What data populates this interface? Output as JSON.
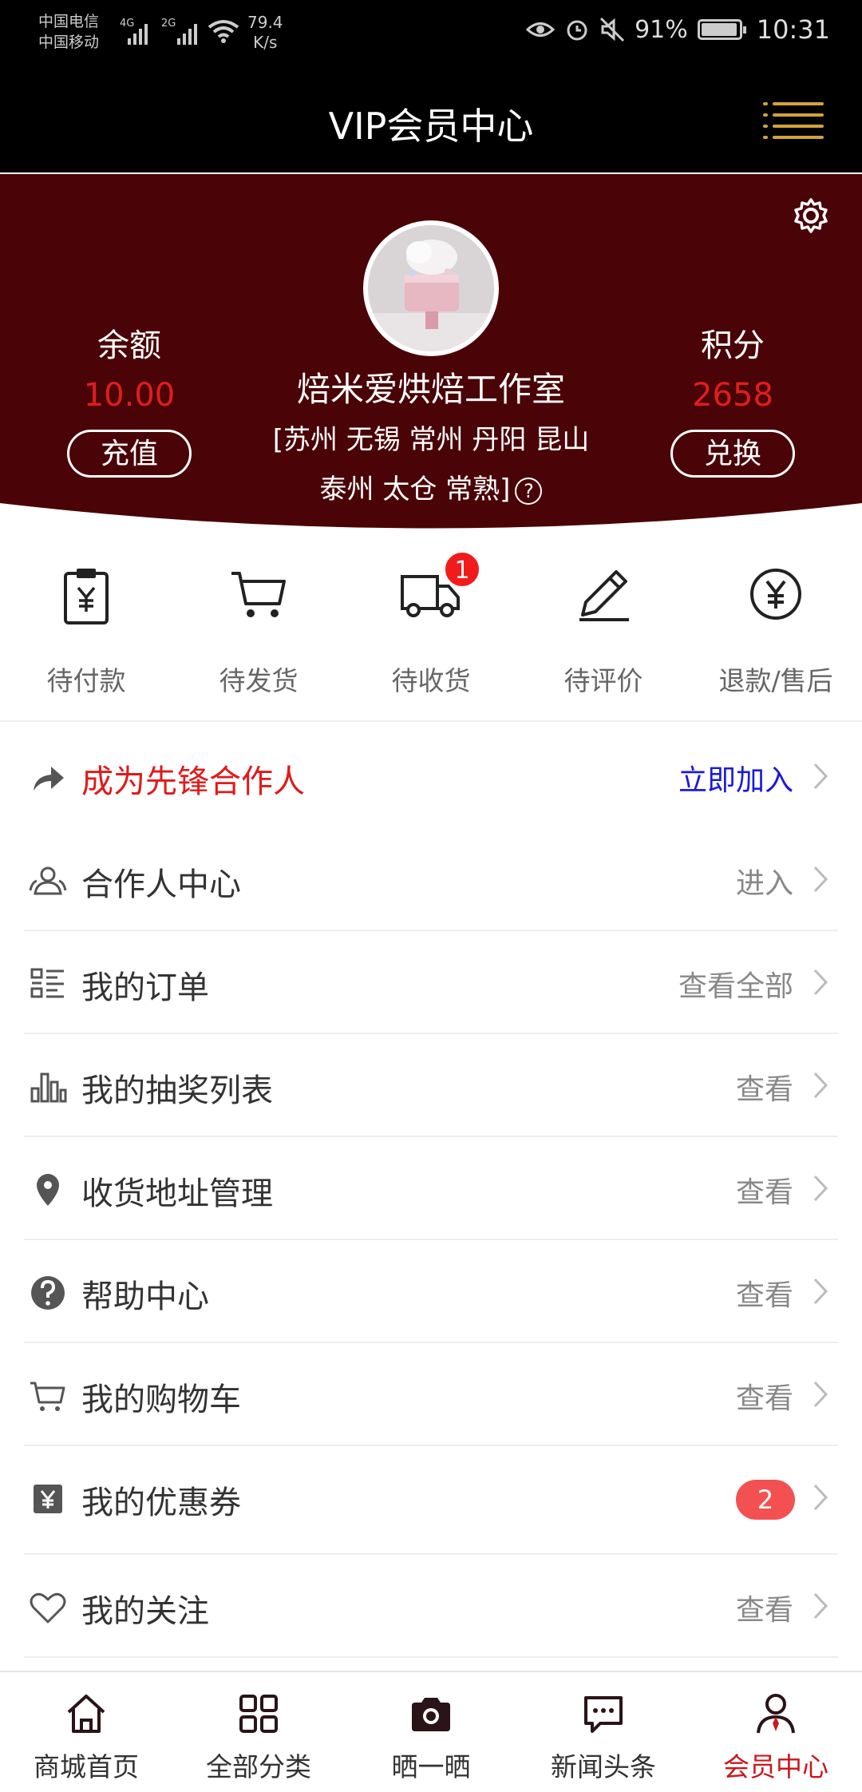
{
  "status_bar": {
    "carrier1": "中国电信",
    "carrier2": "中国移动",
    "net1": "4G",
    "net2": "2G",
    "speed_value": "79.4",
    "speed_unit": "K/s",
    "battery": "91%",
    "time": "10:31"
  },
  "header": {
    "title": "VIP会员中心"
  },
  "profile": {
    "shop_name": "焙米爱烘焙工作室",
    "service_area_line1": "[苏州 无锡 常州 丹阳 昆山",
    "service_area_line2": "泰州 太仓 常熟]",
    "help_glyph": "?",
    "balance": {
      "label": "余额",
      "value": "10.00",
      "button": "充值"
    },
    "points": {
      "label": "积分",
      "value": "2658",
      "button": "兑换"
    }
  },
  "orders": [
    {
      "label": "待付款",
      "icon": "clipboard-yen-icon"
    },
    {
      "label": "待发货",
      "icon": "cart-icon"
    },
    {
      "label": "待收货",
      "icon": "truck-icon",
      "badge": "1"
    },
    {
      "label": "待评价",
      "icon": "pencil-icon"
    },
    {
      "label": "退款/售后",
      "icon": "yen-circle-icon"
    }
  ],
  "menu": [
    {
      "label": "成为先锋合作人",
      "action": "立即加入",
      "icon": "share-arrow-icon"
    },
    {
      "label": "合作人中心",
      "action": "进入",
      "icon": "users-icon"
    },
    {
      "label": "我的订单",
      "action": "查看全部",
      "icon": "list-icon"
    },
    {
      "label": "我的抽奖列表",
      "action": "查看",
      "icon": "bar-chart-icon"
    },
    {
      "label": "收货地址管理",
      "action": "查看",
      "icon": "location-pin-icon"
    },
    {
      "label": "帮助中心",
      "action": "查看",
      "icon": "help-circle-icon"
    },
    {
      "label": "我的购物车",
      "action": "查看",
      "icon": "cart-icon"
    },
    {
      "label": "我的优惠券",
      "badge": "2",
      "icon": "coupon-yen-icon"
    },
    {
      "label": "我的关注",
      "action": "查看",
      "icon": "heart-icon"
    }
  ],
  "tabbar": [
    {
      "label": "商城首页",
      "icon": "home-icon"
    },
    {
      "label": "全部分类",
      "icon": "grid-icon"
    },
    {
      "label": "晒一晒",
      "icon": "camera-icon"
    },
    {
      "label": "新闻头条",
      "icon": "message-icon"
    },
    {
      "label": "会员中心",
      "icon": "member-icon",
      "active": true
    }
  ],
  "colors": {
    "hero_bg": "#4a0307",
    "accent_red": "#e11d1d",
    "highlight_red": "#e01a1a",
    "link_blue": "#1a1adb",
    "menu_gold": "#d1a23c",
    "active_tab": "#c8191e"
  }
}
